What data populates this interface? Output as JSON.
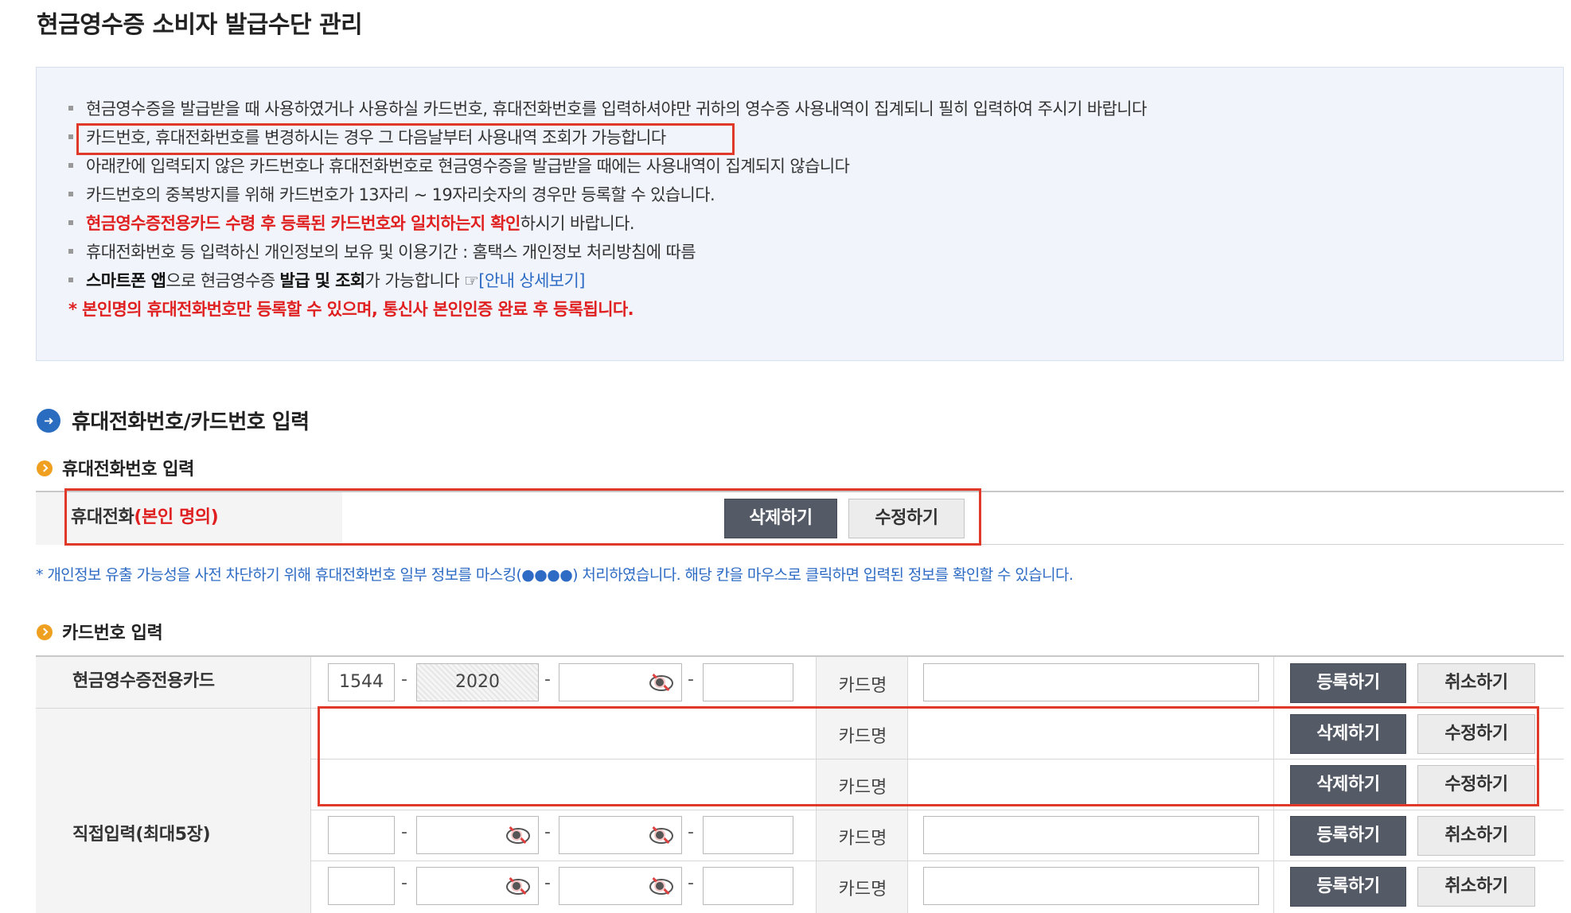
{
  "page": {
    "title": "현금영수증 소비자 발급수단 관리"
  },
  "notice": {
    "lines": [
      "현금영수증을 발급받을 때 사용하였거나 사용하실 카드번호, 휴대전화번호를 입력하셔야만 귀하의 영수증 사용내역이 집계되니 필히 입력하여 주시기 바랍니다",
      "카드번호, 휴대전화번호를 변경하시는 경우 그 다음날부터 사용내역 조회가 가능합니다",
      "아래칸에 입력되지 않은 카드번호나 휴대전화번호로 현금영수증을 발급받을 때에는 사용내역이 집계되지 않습니다",
      "카드번호의 중복방지를 위해 카드번호가 13자리 ~ 19자리숫자의 경우만 등록할 수 있습니다."
    ],
    "line5_red": "현금영수증전용카드 수령 후 등록된 카드번호와 일치하는지 확인",
    "line5_rest": "하시기 바랍니다.",
    "line6": "휴대전화번호 등 입력하신 개인정보의 보유 및 이용기간 : 홈택스 개인정보 처리방침에 따름",
    "line7_bold1": "스마트폰 앱",
    "line7_part2": "으로 현금영수증 ",
    "line7_bold2": "발급 및 조회",
    "line7_part3": "가 가능합니다 ☞",
    "line7_link": "[안내 상세보기]",
    "star_line": "* 본인명의 휴대전화번호만 등록할 수 있으며, 통신사 본인인증 완료 후 등록됩니다."
  },
  "section": {
    "title": "휴대전화번호/카드번호 입력"
  },
  "phone": {
    "subtitle": "휴대전화번호 입력",
    "label": "휴대전화",
    "label_red": "(본인 명의)",
    "delete_label": "삭제하기",
    "edit_label": "수정하기",
    "privacy_note": "* 개인정보 유출 가능성을 사전 차단하기 위해 휴대전화번호 일부 정보를 마스킹(●●●●) 처리하였습니다. 해당 칸을 마우스로 클릭하면 입력된 정보를 확인할 수 있습니다."
  },
  "card": {
    "subtitle": "카드번호 입력",
    "dedicated_label": "현금영수증전용카드",
    "direct_label": "직접입력(최대5장)",
    "card_name_label": "카드명",
    "dash": "-",
    "dedicated_part1": "1544",
    "dedicated_part2": "2020",
    "register_label": "등록하기",
    "cancel_label": "취소하기",
    "delete_label": "삭제하기",
    "edit_label": "수정하기"
  },
  "icons": {
    "section": "arrow-circle-icon",
    "subsection": "chevron-circle-icon",
    "masked": "eye-slash-icon"
  },
  "colors": {
    "accent_blue": "#2a6cc0",
    "warning_red": "#e02020",
    "highlight_box": "#e0392a",
    "dark_button": "#555b66",
    "orange_dot": "#f0a020"
  }
}
